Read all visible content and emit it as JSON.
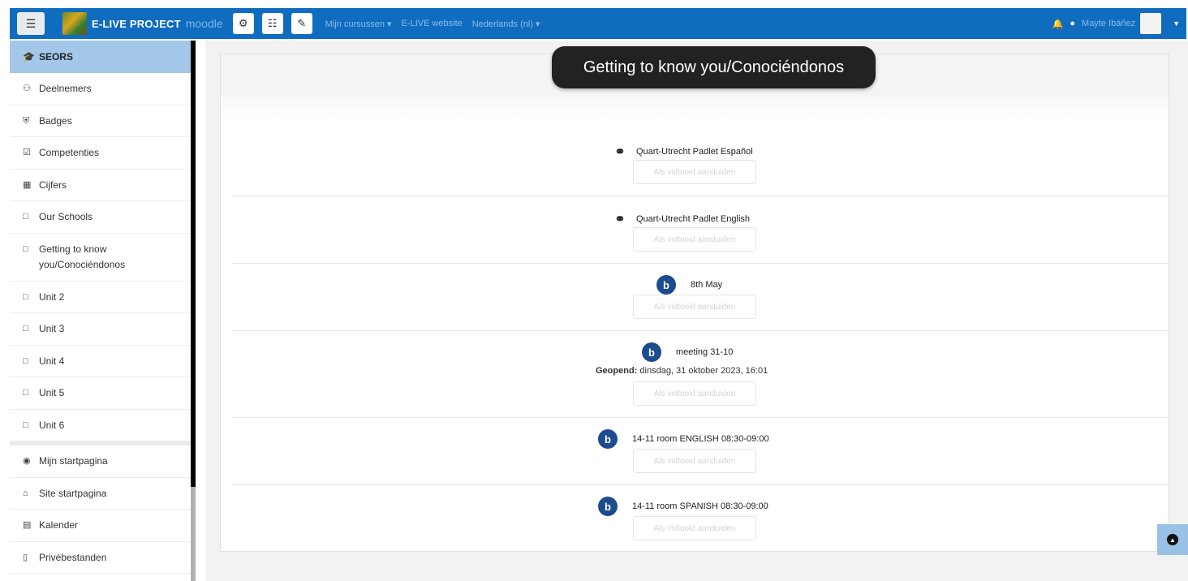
{
  "navbar": {
    "menu_icon": "hamburger-icon",
    "brand": "E-LIVE PROJECT",
    "brand_suffix": "moodle",
    "tool_icons": [
      "cogs-icon",
      "sitemap-icon",
      "edit-icon"
    ],
    "links": [
      "Mijn cursussen",
      "E-LIVE website",
      "Nederlands (nl)"
    ],
    "user_name": "Mayte Ibáñez"
  },
  "sidebar": {
    "course": "SEORS",
    "items": [
      {
        "label": "Deelnemers",
        "icon": "users-icon"
      },
      {
        "label": "Badges",
        "icon": "shield-icon"
      },
      {
        "label": "Competenties",
        "icon": "checkbox-icon"
      },
      {
        "label": "Cijfers",
        "icon": "table-icon"
      },
      {
        "label": "Our Schools",
        "icon": "folder-icon"
      },
      {
        "label": "Getting to know you/Conociéndonos",
        "icon": "folder-icon"
      },
      {
        "label": "Unit 2",
        "icon": "folder-icon"
      },
      {
        "label": "Unit 3",
        "icon": "folder-icon"
      },
      {
        "label": "Unit 4",
        "icon": "folder-icon"
      },
      {
        "label": "Unit 5",
        "icon": "folder-icon"
      },
      {
        "label": "Unit 6",
        "icon": "folder-icon"
      }
    ],
    "bottom_items": [
      {
        "label": "Mijn startpagina",
        "icon": "dashboard-icon"
      },
      {
        "label": "Site startpagina",
        "icon": "home-icon"
      },
      {
        "label": "Kalender",
        "icon": "calendar-icon"
      },
      {
        "label": "Privébestanden",
        "icon": "file-icon"
      }
    ]
  },
  "section": {
    "title": "Getting to know you/Conociéndonos",
    "activities": [
      {
        "type": "url",
        "icon": "link-icon",
        "name": "Quart-Utrecht Padlet Español",
        "button": "Als voltooid aanduiden"
      },
      {
        "type": "url",
        "icon": "link-icon",
        "name": "Quart-Utrecht Padlet English",
        "button": "Als voltooid aanduiden"
      },
      {
        "type": "bbb",
        "icon": "bigbluebutton-icon",
        "name": "8th May",
        "button": "Als voltooid aanduiden"
      },
      {
        "type": "bbb",
        "icon": "bigbluebutton-icon",
        "name": "meeting 31-10",
        "opened_label": "Geopend:",
        "opened_value": "dinsdag, 31 oktober 2023, 16:01",
        "button": "Als voltooid aanduiden"
      },
      {
        "type": "bbb",
        "icon": "bigbluebutton-icon",
        "name": "14-11 room ENGLISH 08:30-09:00",
        "button": "Als voltooid aanduiden"
      },
      {
        "type": "bbb",
        "icon": "bigbluebutton-icon",
        "name": "14-11 room SPANISH 08:30-09:00",
        "button": "Als voltooid aanduiden"
      }
    ]
  },
  "scroll_top_icon": "arrow-up-circle-icon"
}
